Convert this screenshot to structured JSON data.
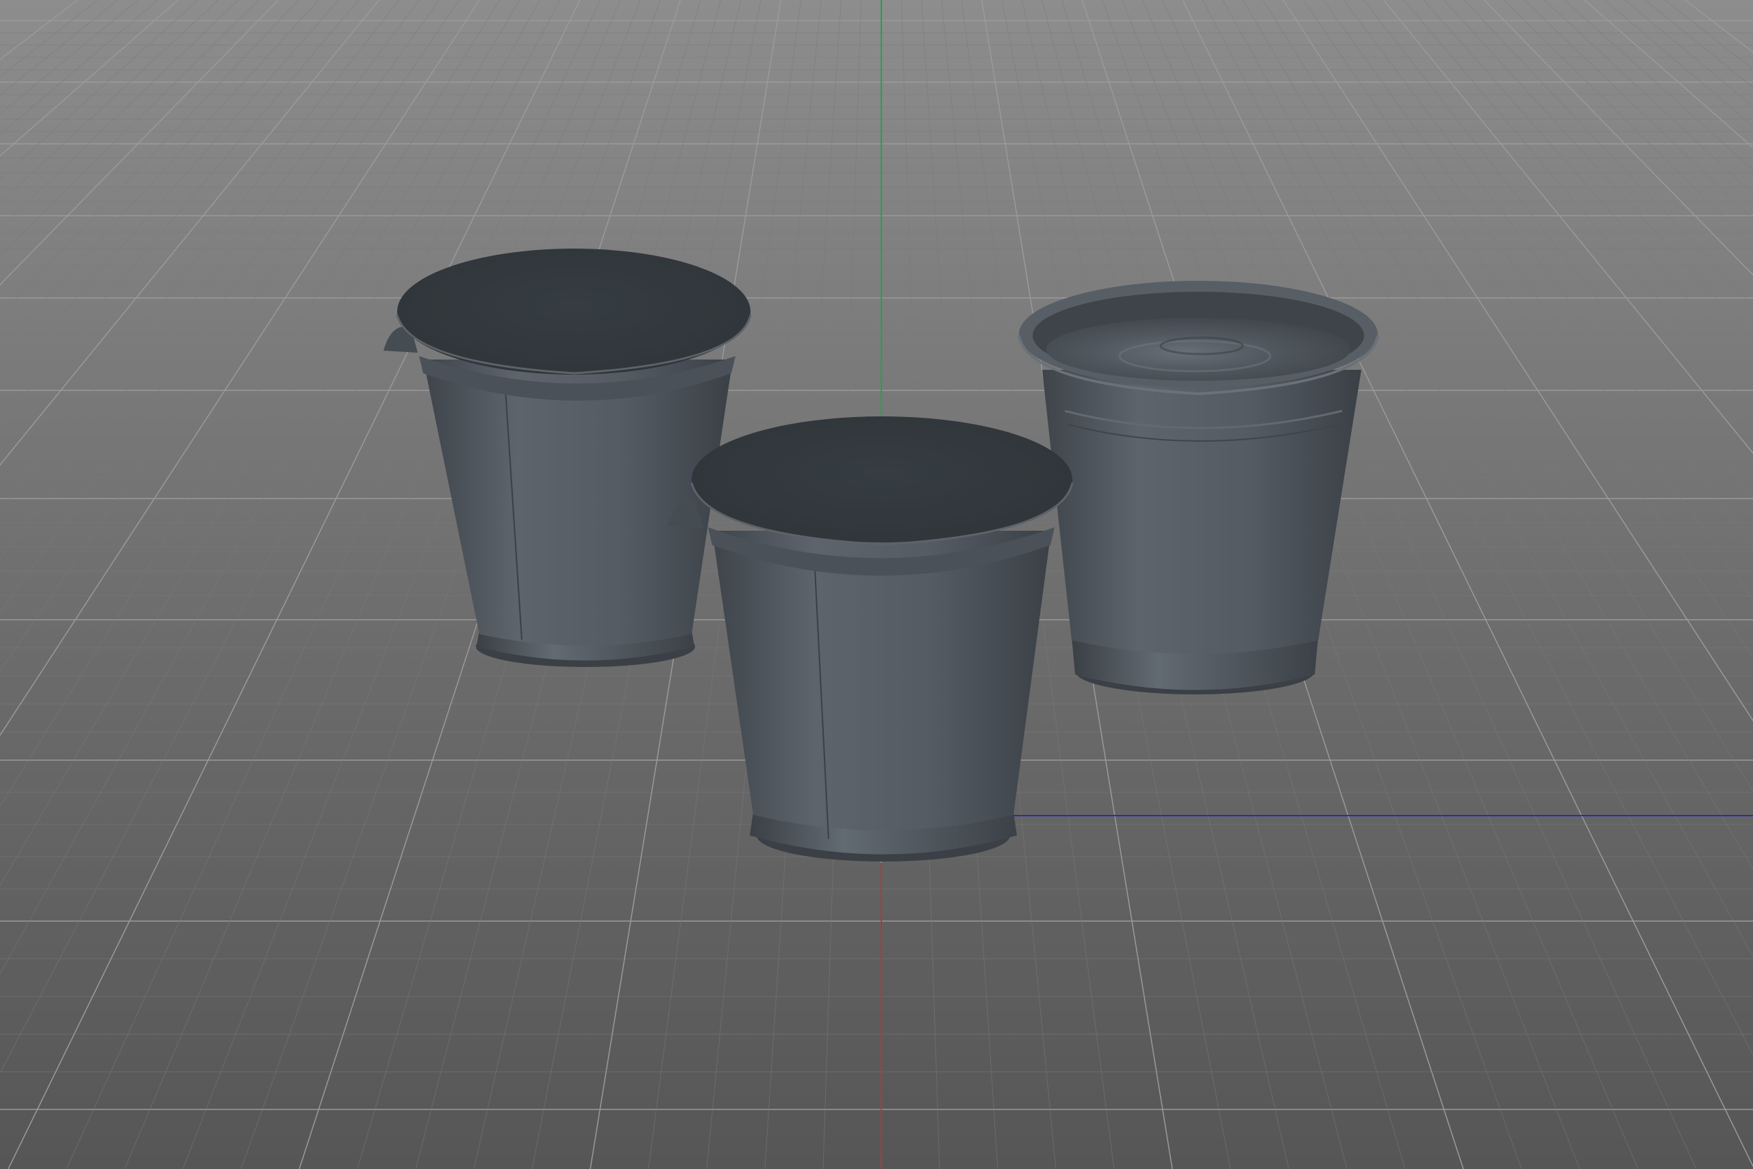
{
  "app": {
    "view": "perspective-3d-viewport"
  },
  "scene": {
    "objects": [
      {
        "id": "cup_left",
        "kind": "yogurt-cup",
        "state": "sealed-lid"
      },
      {
        "id": "cup_center",
        "kind": "yogurt-cup",
        "state": "sealed-lid"
      },
      {
        "id": "cup_right",
        "kind": "yogurt-cup",
        "state": "open-with-contents"
      }
    ],
    "axes": {
      "x_color": "#2a2ac0",
      "y_color": "#22a24a",
      "z_color": "#c03a3a"
    },
    "colors": {
      "background_top": "#8c8c8c",
      "background_bottom": "#575757",
      "grid_major": "#9a9a9a",
      "grid_minor": "#7a7a7a",
      "object_body": "#4e555c",
      "object_lid": "#333a3f"
    }
  }
}
